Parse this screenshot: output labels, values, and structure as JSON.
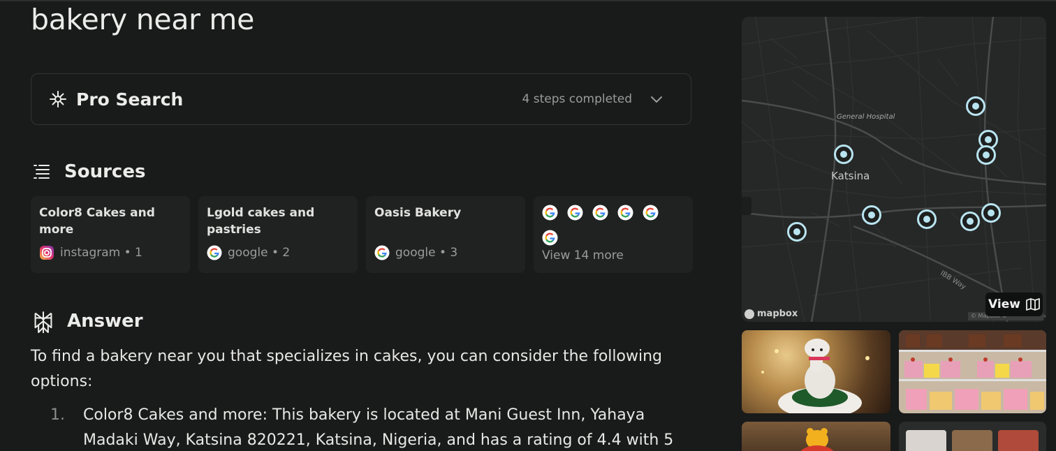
{
  "query": "bakery near me",
  "pro_search": {
    "title": "Pro Search",
    "steps": "4 steps completed"
  },
  "sources": {
    "heading": "Sources",
    "cards": [
      {
        "title": "Color8 Cakes and more",
        "site": "instagram",
        "index": "1"
      },
      {
        "title": "Lgold cakes and pastries",
        "site": "google",
        "index": "2"
      },
      {
        "title": "Oasis Bakery",
        "site": "google",
        "index": "3"
      }
    ],
    "view_more": "View 14 more"
  },
  "answer": {
    "heading": "Answer",
    "intro": "To find a bakery near you that specializes in cakes, you can consider the following options:",
    "items": [
      {
        "num": "1.",
        "text": "Color8 Cakes and more: This bakery is located at Mani Guest Inn, Yahaya Madaki Way, Katsina 820221, Katsina, Nigeria, and has a rating of 4.4 with 5"
      }
    ]
  },
  "map": {
    "place_label": "General Hospital",
    "city_label": "Katsina",
    "road_label": "IBB Way",
    "brand": "mapbox",
    "attribution": "© Mapbox © OpenStreetMap",
    "view_label": "View"
  },
  "colors": {
    "background": "#191a1a",
    "pin": "#b8e4ef",
    "card": "#202222"
  }
}
